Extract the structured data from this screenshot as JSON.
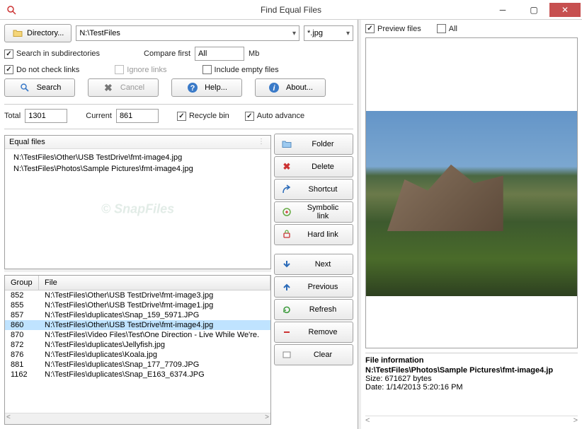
{
  "window": {
    "title": "Find Equal Files"
  },
  "toolbar": {
    "directory_label": "Directory...",
    "directory_value": "N:\\TestFiles",
    "pattern_value": "*.jpg"
  },
  "options": {
    "search_subdirs": "Search in subdirectories",
    "compare_first": "Compare first",
    "compare_unit": "Mb",
    "compare_value": "All",
    "do_not_check_links": "Do not check links",
    "ignore_links": "Ignore links",
    "include_empty": "Include empty files"
  },
  "buttons": {
    "search": "Search",
    "cancel": "Cancel",
    "help": "Help...",
    "about": "About..."
  },
  "stats": {
    "total_label": "Total",
    "total_value": "1301",
    "current_label": "Current",
    "current_value": "861",
    "recycle_bin": "Recycle bin",
    "auto_advance": "Auto advance"
  },
  "equal": {
    "header": "Equal files",
    "files": [
      "N:\\TestFiles\\Other\\USB TestDrive\\fmt-image4.jpg",
      "N:\\TestFiles\\Photos\\Sample Pictures\\fmt-image4.jpg"
    ]
  },
  "mid_buttons": {
    "folder": "Folder",
    "delete": "Delete",
    "shortcut": "Shortcut",
    "symbolic": "Symbolic link",
    "hardlink": "Hard link",
    "next": "Next",
    "previous": "Previous",
    "refresh": "Refresh",
    "remove": "Remove",
    "clear": "Clear"
  },
  "list": {
    "headers": {
      "group": "Group",
      "file": "File"
    },
    "selected_group": "860",
    "rows": [
      {
        "group": "852",
        "file": "N:\\TestFiles\\Other\\USB TestDrive\\fmt-image3.jpg"
      },
      {
        "group": "855",
        "file": "N:\\TestFiles\\Other\\USB TestDrive\\fmt-image1.jpg"
      },
      {
        "group": "857",
        "file": "N:\\TestFiles\\duplicates\\Snap_159_5971.JPG"
      },
      {
        "group": "860",
        "file": "N:\\TestFiles\\Other\\USB TestDrive\\fmt-image4.jpg"
      },
      {
        "group": "870",
        "file": "N:\\TestFiles\\Video Files\\Test\\One Direction - Live While We're."
      },
      {
        "group": "872",
        "file": "N:\\TestFiles\\duplicates\\Jellyfish.jpg"
      },
      {
        "group": "876",
        "file": "N:\\TestFiles\\duplicates\\Koala.jpg"
      },
      {
        "group": "881",
        "file": "N:\\TestFiles\\duplicates\\Snap_177_7709.JPG"
      },
      {
        "group": "1162",
        "file": "N:\\TestFiles\\duplicates\\Snap_E163_6374.JPG"
      }
    ]
  },
  "preview": {
    "preview_files": "Preview files",
    "all": "All"
  },
  "file_info": {
    "heading": "File information",
    "path": "N:\\TestFiles\\Photos\\Sample Pictures\\fmt-image4.jp",
    "size": "Size: 671627 bytes",
    "date": "Date: 1/14/2013 5:20:16 PM"
  }
}
